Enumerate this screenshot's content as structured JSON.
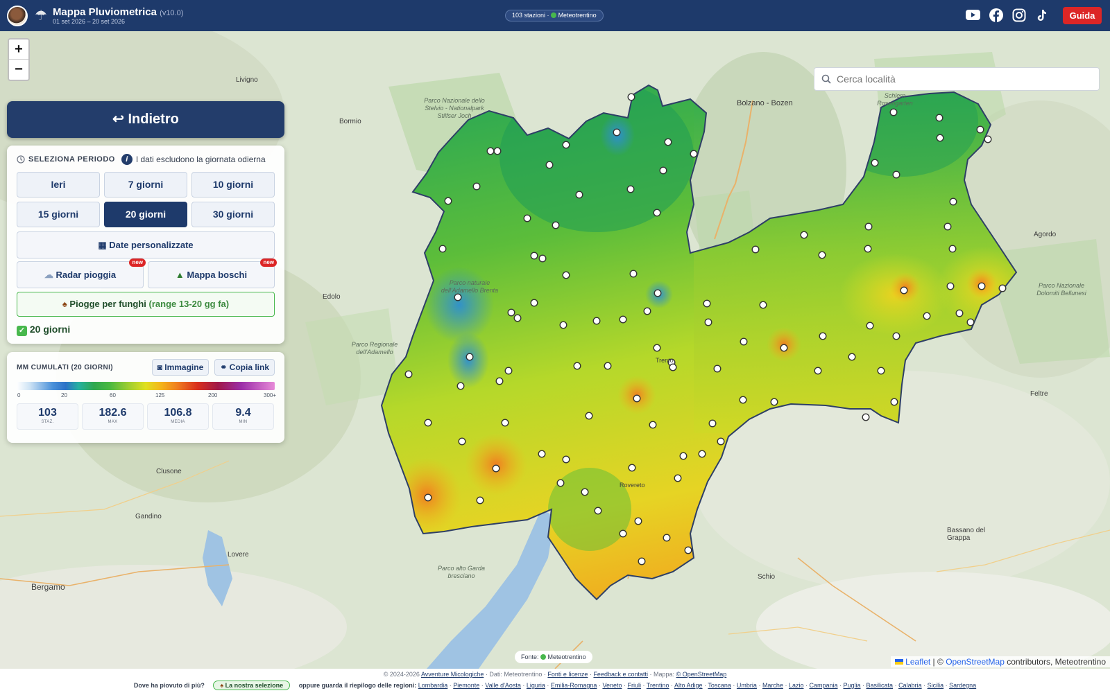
{
  "header": {
    "app_title": "Mappa Pluviometrica",
    "version": "(v10.0)",
    "date_range": "01 set 2026 – 20 set 2026",
    "status_count": "103 stazioni ·",
    "status_source": "Meteotrentino",
    "guide_label": "Guida",
    "socials": [
      "youtube-icon",
      "facebook-icon",
      "instagram-icon",
      "tiktok-icon"
    ]
  },
  "map": {
    "search_placeholder": "Cerca località",
    "zoom_in": "+",
    "zoom_out": "−",
    "source_label": "Fonte:",
    "source_name": "Meteotrentino",
    "attribution_leaflet": "Leaflet",
    "attribution_sep": "| ©",
    "attribution_osm": "OpenStreetMap",
    "attribution_rest": "contributors, Meteotrentino",
    "labels": {
      "stelvio": "Parco Nazionale dello Stelvio - Nationalpark Stilfser Joch",
      "adamello_brenta": "Parco naturale dell'Adamello Brenta",
      "adamello": "Parco Regionale dell'Adamello",
      "garda": "Parco alto Garda bresciano",
      "schlern": "Schlern Rosengarten",
      "dolomiti": "Parco Nazionale Dolomiti Bellunesi"
    },
    "cities": {
      "bolzano": "Bolzano - Bozen",
      "bergamo": "Bergamo",
      "bormio": "Bormio",
      "livigno": "Livigno",
      "edolo": "Edolo",
      "agordo": "Agordo",
      "feltre": "Feltre",
      "bassano": "Bassano del Grappa",
      "schio": "Schio",
      "lovere": "Lovere",
      "gandino": "Gandino",
      "clusone": "Clusone",
      "trento": "Trento",
      "rovereto": "Rovereto"
    }
  },
  "sidebar": {
    "back_label": "↩ Indietro",
    "period_title": "SELEZIONA PERIODO",
    "info_icon": "i",
    "info_text": "I dati escludono la giornata odierna",
    "periods": [
      "Ieri",
      "7 giorni",
      "10 giorni",
      "15 giorni",
      "20 giorni",
      "30 giorni"
    ],
    "active_period": "20 giorni",
    "custom_dates": "Date personalizzate",
    "radar": "Radar pioggia",
    "woods": "Mappa boschi",
    "new_badge": "new",
    "mushrooms": "Piogge per funghi",
    "mushrooms_range": "(range 13-20 gg fa)",
    "selected_period": "20 giorni"
  },
  "legend": {
    "title": "MM CUMULATI (20 GIORNI)",
    "image_btn": "Immagine",
    "copy_btn": "Copia link",
    "ticks": [
      "0",
      "20",
      "60",
      "125",
      "200",
      "300+"
    ],
    "stats": [
      {
        "value": "103",
        "label": "STAZ."
      },
      {
        "value": "182.6",
        "label": "MAX"
      },
      {
        "value": "106.8",
        "label": "MEDIA"
      },
      {
        "value": "9.4",
        "label": "MIN"
      }
    ]
  },
  "footer": {
    "copyright": "© 2024-2026",
    "site_link": "Avventure Micologiche",
    "data_text": "· Dati: Meteotrentino ·",
    "fonti": "Fonti e licenze",
    "feedback": "Feedback e contatti",
    "map_text": "· Mappa:",
    "osm": "© OpenStreetMap",
    "question": "Dove ha piovuto di più?",
    "selection": "La nostra selezione",
    "regions_intro": "oppure guarda il riepilogo delle regioni:",
    "regions": [
      "Lombardia",
      "Piemonte",
      "Valle d'Aosta",
      "Liguria",
      "Emilia-Romagna",
      "Veneto",
      "Friuli",
      "Trentino",
      "Alto Adige",
      "Toscana",
      "Umbria",
      "Marche",
      "Lazio",
      "Campania",
      "Puglia",
      "Basilicata",
      "Calabria",
      "Sicilia",
      "Sardegna"
    ]
  },
  "colors": {
    "header_bg": "#1e3a6b",
    "accent_red": "#dc2626",
    "status_green": "#48b84d"
  }
}
